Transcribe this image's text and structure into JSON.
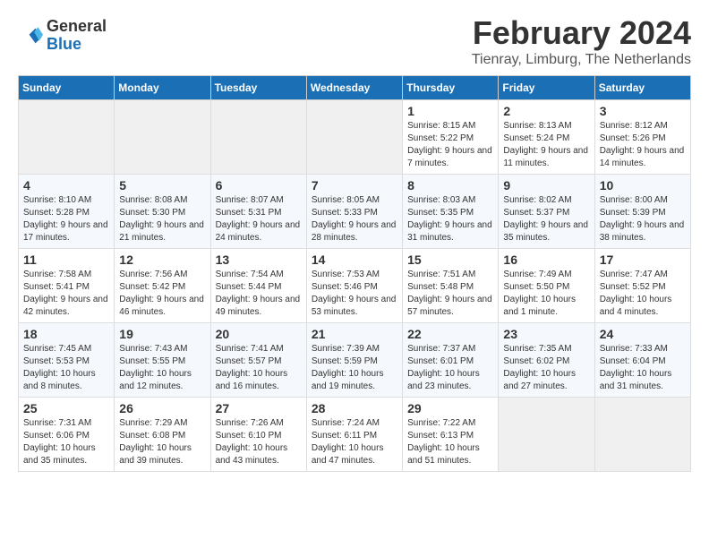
{
  "header": {
    "logo_general": "General",
    "logo_blue": "Blue",
    "month_title": "February 2024",
    "location": "Tienray, Limburg, The Netherlands"
  },
  "days_of_week": [
    "Sunday",
    "Monday",
    "Tuesday",
    "Wednesday",
    "Thursday",
    "Friday",
    "Saturday"
  ],
  "weeks": [
    [
      {
        "day": "",
        "empty": true
      },
      {
        "day": "",
        "empty": true
      },
      {
        "day": "",
        "empty": true
      },
      {
        "day": "",
        "empty": true
      },
      {
        "day": "1",
        "sunrise": "8:15 AM",
        "sunset": "5:22 PM",
        "daylight": "9 hours and 7 minutes."
      },
      {
        "day": "2",
        "sunrise": "8:13 AM",
        "sunset": "5:24 PM",
        "daylight": "9 hours and 11 minutes."
      },
      {
        "day": "3",
        "sunrise": "8:12 AM",
        "sunset": "5:26 PM",
        "daylight": "9 hours and 14 minutes."
      }
    ],
    [
      {
        "day": "4",
        "sunrise": "8:10 AM",
        "sunset": "5:28 PM",
        "daylight": "9 hours and 17 minutes."
      },
      {
        "day": "5",
        "sunrise": "8:08 AM",
        "sunset": "5:30 PM",
        "daylight": "9 hours and 21 minutes."
      },
      {
        "day": "6",
        "sunrise": "8:07 AM",
        "sunset": "5:31 PM",
        "daylight": "9 hours and 24 minutes."
      },
      {
        "day": "7",
        "sunrise": "8:05 AM",
        "sunset": "5:33 PM",
        "daylight": "9 hours and 28 minutes."
      },
      {
        "day": "8",
        "sunrise": "8:03 AM",
        "sunset": "5:35 PM",
        "daylight": "9 hours and 31 minutes."
      },
      {
        "day": "9",
        "sunrise": "8:02 AM",
        "sunset": "5:37 PM",
        "daylight": "9 hours and 35 minutes."
      },
      {
        "day": "10",
        "sunrise": "8:00 AM",
        "sunset": "5:39 PM",
        "daylight": "9 hours and 38 minutes."
      }
    ],
    [
      {
        "day": "11",
        "sunrise": "7:58 AM",
        "sunset": "5:41 PM",
        "daylight": "9 hours and 42 minutes."
      },
      {
        "day": "12",
        "sunrise": "7:56 AM",
        "sunset": "5:42 PM",
        "daylight": "9 hours and 46 minutes."
      },
      {
        "day": "13",
        "sunrise": "7:54 AM",
        "sunset": "5:44 PM",
        "daylight": "9 hours and 49 minutes."
      },
      {
        "day": "14",
        "sunrise": "7:53 AM",
        "sunset": "5:46 PM",
        "daylight": "9 hours and 53 minutes."
      },
      {
        "day": "15",
        "sunrise": "7:51 AM",
        "sunset": "5:48 PM",
        "daylight": "9 hours and 57 minutes."
      },
      {
        "day": "16",
        "sunrise": "7:49 AM",
        "sunset": "5:50 PM",
        "daylight": "10 hours and 1 minute."
      },
      {
        "day": "17",
        "sunrise": "7:47 AM",
        "sunset": "5:52 PM",
        "daylight": "10 hours and 4 minutes."
      }
    ],
    [
      {
        "day": "18",
        "sunrise": "7:45 AM",
        "sunset": "5:53 PM",
        "daylight": "10 hours and 8 minutes."
      },
      {
        "day": "19",
        "sunrise": "7:43 AM",
        "sunset": "5:55 PM",
        "daylight": "10 hours and 12 minutes."
      },
      {
        "day": "20",
        "sunrise": "7:41 AM",
        "sunset": "5:57 PM",
        "daylight": "10 hours and 16 minutes."
      },
      {
        "day": "21",
        "sunrise": "7:39 AM",
        "sunset": "5:59 PM",
        "daylight": "10 hours and 19 minutes."
      },
      {
        "day": "22",
        "sunrise": "7:37 AM",
        "sunset": "6:01 PM",
        "daylight": "10 hours and 23 minutes."
      },
      {
        "day": "23",
        "sunrise": "7:35 AM",
        "sunset": "6:02 PM",
        "daylight": "10 hours and 27 minutes."
      },
      {
        "day": "24",
        "sunrise": "7:33 AM",
        "sunset": "6:04 PM",
        "daylight": "10 hours and 31 minutes."
      }
    ],
    [
      {
        "day": "25",
        "sunrise": "7:31 AM",
        "sunset": "6:06 PM",
        "daylight": "10 hours and 35 minutes."
      },
      {
        "day": "26",
        "sunrise": "7:29 AM",
        "sunset": "6:08 PM",
        "daylight": "10 hours and 39 minutes."
      },
      {
        "day": "27",
        "sunrise": "7:26 AM",
        "sunset": "6:10 PM",
        "daylight": "10 hours and 43 minutes."
      },
      {
        "day": "28",
        "sunrise": "7:24 AM",
        "sunset": "6:11 PM",
        "daylight": "10 hours and 47 minutes."
      },
      {
        "day": "29",
        "sunrise": "7:22 AM",
        "sunset": "6:13 PM",
        "daylight": "10 hours and 51 minutes."
      },
      {
        "day": "",
        "empty": true
      },
      {
        "day": "",
        "empty": true
      }
    ]
  ]
}
